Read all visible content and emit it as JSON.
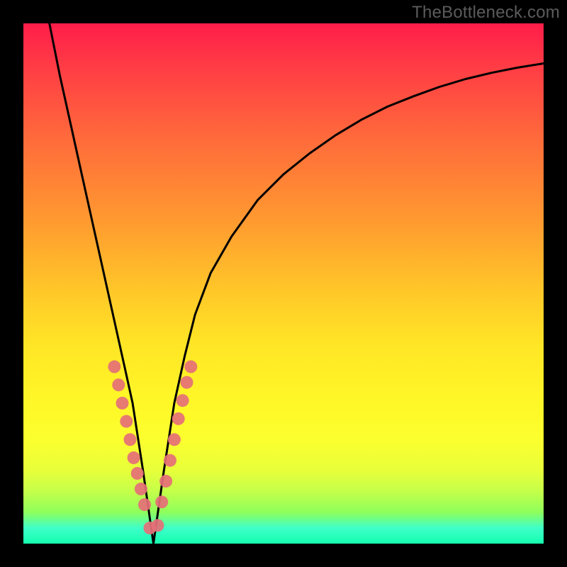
{
  "watermark": "TheBottleneck.com",
  "colors": {
    "frame": "#000000",
    "curve": "#000000",
    "point": "#e56f77",
    "gradient_top": "#ff1d4a",
    "gradient_bottom": "#15ffb0"
  },
  "chart_data": {
    "type": "line",
    "title": "",
    "xlabel": "",
    "ylabel": "",
    "xlim": [
      0,
      100
    ],
    "ylim": [
      0,
      100
    ],
    "grid": false,
    "legend": false,
    "note": "Axis values are estimated in percent of plot width/height; y increases upward. Curve is a V-shaped bottleneck curve with minimum near x≈25.",
    "series": [
      {
        "name": "bottleneck-curve",
        "x": [
          5,
          7,
          9,
          11,
          13,
          15,
          17,
          19,
          21,
          23,
          25,
          27,
          29,
          31,
          33,
          36,
          40,
          45,
          50,
          55,
          60,
          65,
          70,
          75,
          80,
          85,
          90,
          95,
          100
        ],
        "y": [
          100,
          90,
          81,
          72,
          63,
          54,
          45,
          36,
          27,
          14,
          0,
          14,
          27,
          36,
          44,
          52,
          59,
          66,
          71,
          75,
          78.5,
          81.5,
          84,
          86,
          87.8,
          89.3,
          90.5,
          91.5,
          92.3
        ]
      }
    ],
    "points_overlay": {
      "name": "sample-points-near-minimum",
      "note": "Pink dots clustered along the curve near the bottom of the V.",
      "x": [
        17.5,
        18.3,
        19.0,
        19.8,
        20.5,
        21.2,
        21.9,
        22.6,
        23.3,
        24.3,
        25.8,
        26.6,
        27.4,
        28.2,
        29.0,
        29.8,
        30.6,
        31.4,
        32.2
      ],
      "y": [
        34.0,
        30.5,
        27.0,
        23.5,
        20.0,
        16.5,
        13.5,
        10.5,
        7.5,
        3.0,
        3.5,
        8.0,
        12.0,
        16.0,
        20.0,
        24.0,
        27.5,
        31.0,
        34.0
      ]
    }
  }
}
